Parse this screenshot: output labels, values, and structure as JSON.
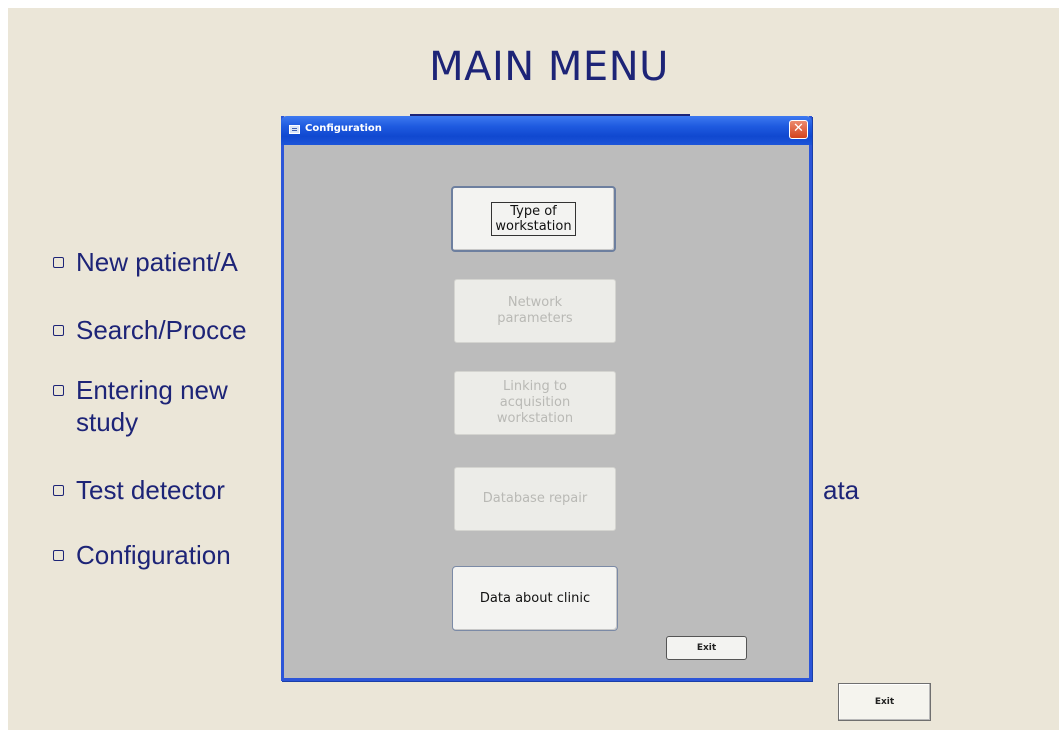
{
  "main": {
    "title": "MAIN MENU",
    "items": [
      {
        "label": "New patient/A"
      },
      {
        "label": "Search/Procce"
      },
      {
        "label": "Entering new",
        "label_line2": "study"
      },
      {
        "label": "Test detector",
        "trailing": "ata"
      },
      {
        "label": "Configuration"
      }
    ],
    "exit_label": "Exit"
  },
  "dialog": {
    "title": "Configuration",
    "close_glyph": "✕",
    "buttons": {
      "type_workstation_line1": "Type of",
      "type_workstation_line2": "workstation",
      "network_line1": "Network",
      "network_line2": "parameters",
      "linking_line1": "Linking to",
      "linking_line2": "acquisition",
      "linking_line3": "workstation",
      "db_repair": "Database repair",
      "clinic": "Data about clinic",
      "exit": "Exit"
    }
  },
  "colors": {
    "background": "#ebe6d8",
    "text_navy": "#1d2477",
    "dialog_border": "#2c55d8",
    "dialog_body": "#bcbcbc"
  },
  "icons": {
    "window_icon": "window-icon",
    "close_icon": "close-icon",
    "bullet_icon": "checkbox-bullet-icon"
  }
}
